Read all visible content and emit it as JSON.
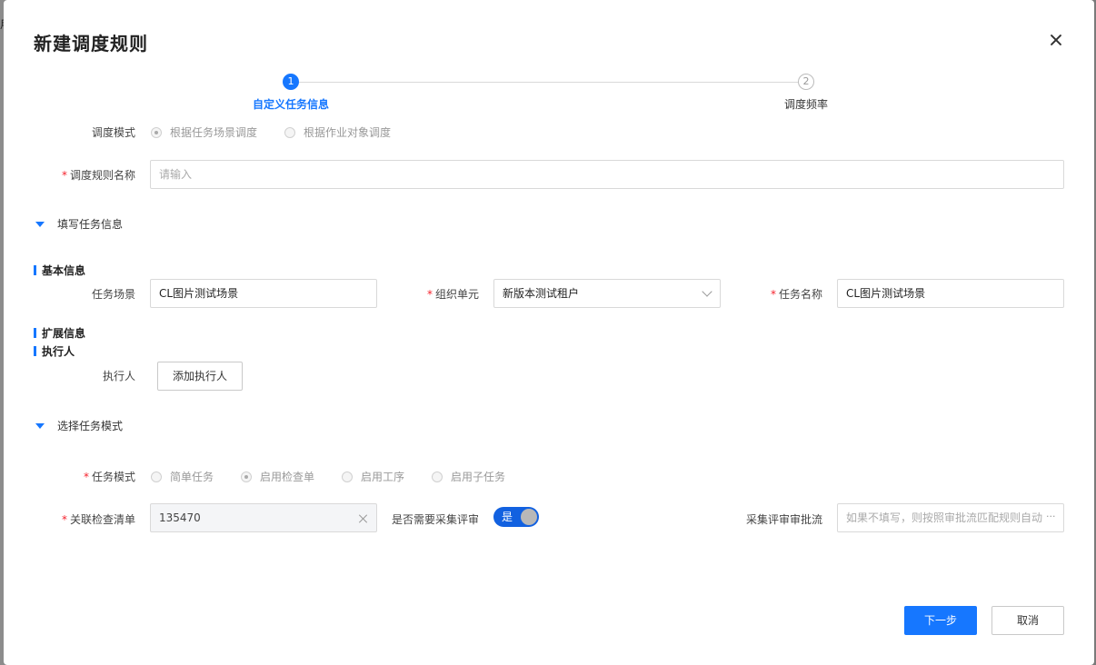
{
  "backdrop": {
    "glyph": "用"
  },
  "dialog": {
    "title": "新建调度规则"
  },
  "steps": [
    {
      "number": "1",
      "label": "自定义任务信息"
    },
    {
      "number": "2",
      "label": "调度频率"
    }
  ],
  "schedule_mode": {
    "label": "调度模式",
    "options": [
      "根据任务场景调度",
      "根据作业对象调度"
    ],
    "selected": "根据任务场景调度"
  },
  "rule_name": {
    "required_mark": "*",
    "label": "调度规则名称",
    "placeholder": "请输入"
  },
  "section_fill_task": {
    "label": "填写任务信息"
  },
  "basic_info": {
    "heading": "基本信息",
    "task_scene": {
      "label": "任务场景",
      "value": "CL图片测试场景"
    },
    "org_unit": {
      "required_mark": "*",
      "label": "组织单元",
      "value": "新版本测试租户"
    },
    "task_name": {
      "required_mark": "*",
      "label": "任务名称",
      "value": "CL图片测试场景"
    }
  },
  "extended_info": {
    "heading": "扩展信息"
  },
  "executor": {
    "heading": "执行人",
    "label": "执行人",
    "add_button": "添加执行人"
  },
  "section_task_mode": {
    "label": "选择任务模式"
  },
  "task_mode": {
    "required_mark": "*",
    "label": "任务模式",
    "options": [
      "简单任务",
      "启用检查单",
      "启用工序",
      "启用子任务"
    ],
    "selected": "启用检查单"
  },
  "checklist": {
    "required_mark": "*",
    "label": "关联检查清单",
    "value": "135470"
  },
  "review_required": {
    "label": "是否需要采集评审",
    "switch_text": "是"
  },
  "review_flow": {
    "label": "采集评审审批流",
    "placeholder": "如果不填写，则按照审批流匹配规则自动",
    "more": "···"
  },
  "footer": {
    "next": "下一步",
    "cancel": "取消"
  },
  "colors": {
    "primary": "#1677ff",
    "required": "#f5222d"
  }
}
